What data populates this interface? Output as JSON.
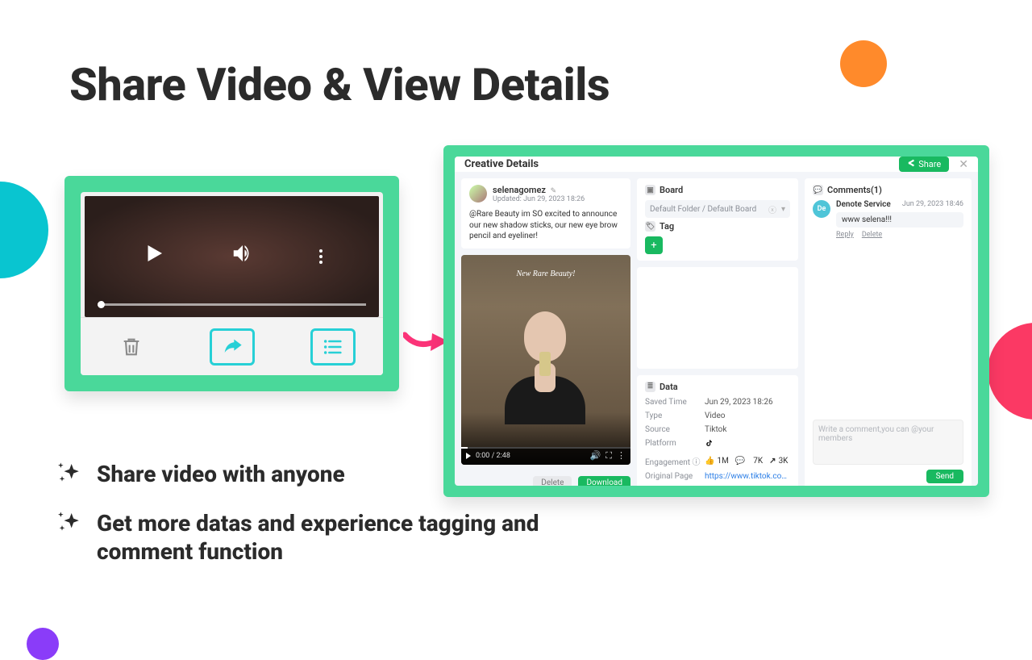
{
  "title": "Share Video & View Details",
  "bullets": [
    "Share video with anyone",
    "Get more datas and experience tagging and comment function"
  ],
  "player": {
    "progress_time": ""
  },
  "details": {
    "header": "Creative Details",
    "share_label": "Share",
    "post": {
      "username": "selenagomez",
      "verified_badge": "✎",
      "updated": "Updated: Jun 29, 2023 18:26",
      "caption": "@Rare Beauty im SO excited to announce our new shadow sticks, our new eye brow pencil and eyeliner!",
      "overlay_title": "New Rare Beauty!",
      "controls_time": "0:00 / 2:48",
      "delete_label": "Delete",
      "download_label": "Download"
    },
    "board": {
      "section_label": "Board",
      "selected": "Default Folder / Default Board"
    },
    "tag": {
      "section_label": "Tag"
    },
    "data": {
      "section_label": "Data",
      "rows": {
        "saved_time_k": "Saved Time",
        "saved_time_v": "Jun 29, 2023 18:26",
        "type_k": "Type",
        "type_v": "Video",
        "source_k": "Source",
        "source_v": "Tiktok",
        "platform_k": "Platform",
        "engagement_k": "Engagement",
        "engagement_likes": "1M",
        "engagement_comments": "7K",
        "engagement_shares": "3K",
        "original_k": "Original Page",
        "original_v": "https://www.tiktok.com/@sele…"
      }
    },
    "comments": {
      "section_label": "Comments(1)",
      "items": [
        {
          "avatar_initials": "De",
          "user": "Denote Service",
          "time": "Jun 29, 2023 18:46",
          "text": "www selena!!!",
          "reply": "Reply",
          "delete": "Delete"
        }
      ],
      "placeholder": "Write a comment,you can @your members",
      "send_label": "Send"
    }
  }
}
